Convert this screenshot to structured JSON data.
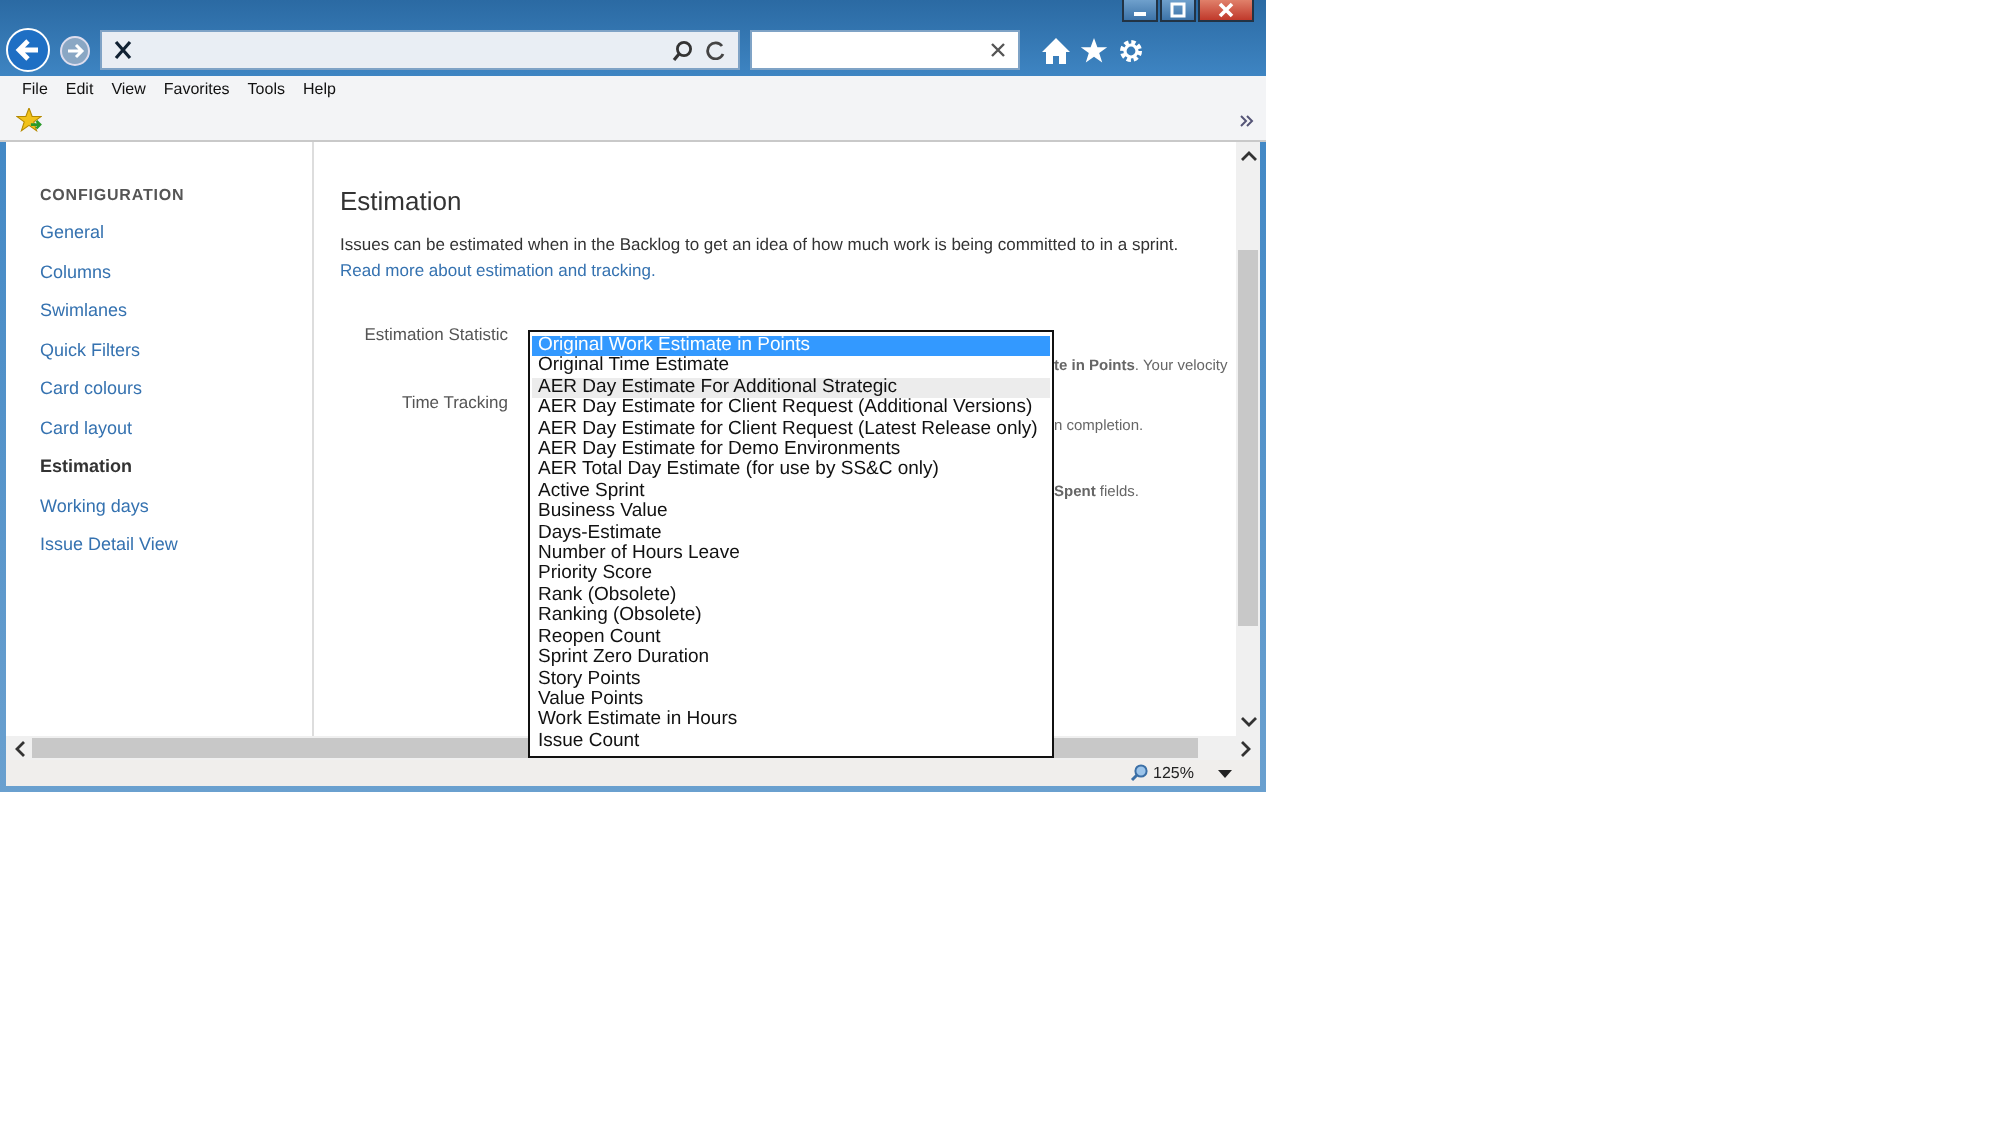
{
  "menu_bar": [
    "File",
    "Edit",
    "View",
    "Favorites",
    "Tools",
    "Help"
  ],
  "sidebar": {
    "heading": "CONFIGURATION",
    "items": [
      {
        "label": "General",
        "selected": false
      },
      {
        "label": "Columns",
        "selected": false
      },
      {
        "label": "Swimlanes",
        "selected": false
      },
      {
        "label": "Quick Filters",
        "selected": false
      },
      {
        "label": "Card colours",
        "selected": false
      },
      {
        "label": "Card layout",
        "selected": false
      },
      {
        "label": "Estimation",
        "selected": true
      },
      {
        "label": "Working days",
        "selected": false
      },
      {
        "label": "Issue Detail View",
        "selected": false
      }
    ]
  },
  "main": {
    "title": "Estimation",
    "intro": "Issues can be estimated when in the Backlog to get an idea of how much work is being committed to in a sprint.",
    "link": "Read more about estimation and tracking.",
    "fields": [
      {
        "label": "Estimation Statistic",
        "help": "**te in Points**. Your velocity"
      },
      {
        "label": "Time Tracking",
        "help": "n completion.",
        "help_2": "**Spent** fields."
      }
    ]
  },
  "dropdown": {
    "options": [
      {
        "label": "Original Work Estimate in Points",
        "selected": true,
        "hovered": false
      },
      {
        "label": "Original Time Estimate",
        "selected": false,
        "hovered": false
      },
      {
        "label": "AER Day Estimate For Additional Strategic",
        "selected": false,
        "hovered": true
      },
      {
        "label": "AER Day Estimate for Client Request (Additional Versions)",
        "selected": false,
        "hovered": false
      },
      {
        "label": "AER Day Estimate for Client Request (Latest Release only)",
        "selected": false,
        "hovered": false
      },
      {
        "label": "AER Day Estimate for Demo Environments",
        "selected": false,
        "hovered": false
      },
      {
        "label": "AER Total Day Estimate (for use by SS&C only)",
        "selected": false,
        "hovered": false
      },
      {
        "label": "Active Sprint",
        "selected": false,
        "hovered": false
      },
      {
        "label": "Business Value",
        "selected": false,
        "hovered": false
      },
      {
        "label": "Days-Estimate",
        "selected": false,
        "hovered": false
      },
      {
        "label": "Number of Hours Leave",
        "selected": false,
        "hovered": false
      },
      {
        "label": "Priority Score",
        "selected": false,
        "hovered": false
      },
      {
        "label": "Rank (Obsolete)",
        "selected": false,
        "hovered": false
      },
      {
        "label": "Ranking (Obsolete)",
        "selected": false,
        "hovered": false
      },
      {
        "label": "Reopen Count",
        "selected": false,
        "hovered": false
      },
      {
        "label": "Sprint Zero Duration",
        "selected": false,
        "hovered": false
      },
      {
        "label": "Story Points",
        "selected": false,
        "hovered": false
      },
      {
        "label": "Value Points",
        "selected": false,
        "hovered": false
      },
      {
        "label": "Work Estimate in Hours",
        "selected": false,
        "hovered": false
      },
      {
        "label": "Issue Count",
        "selected": false,
        "hovered": false
      }
    ]
  },
  "status_bar": {
    "zoom": "125%"
  }
}
